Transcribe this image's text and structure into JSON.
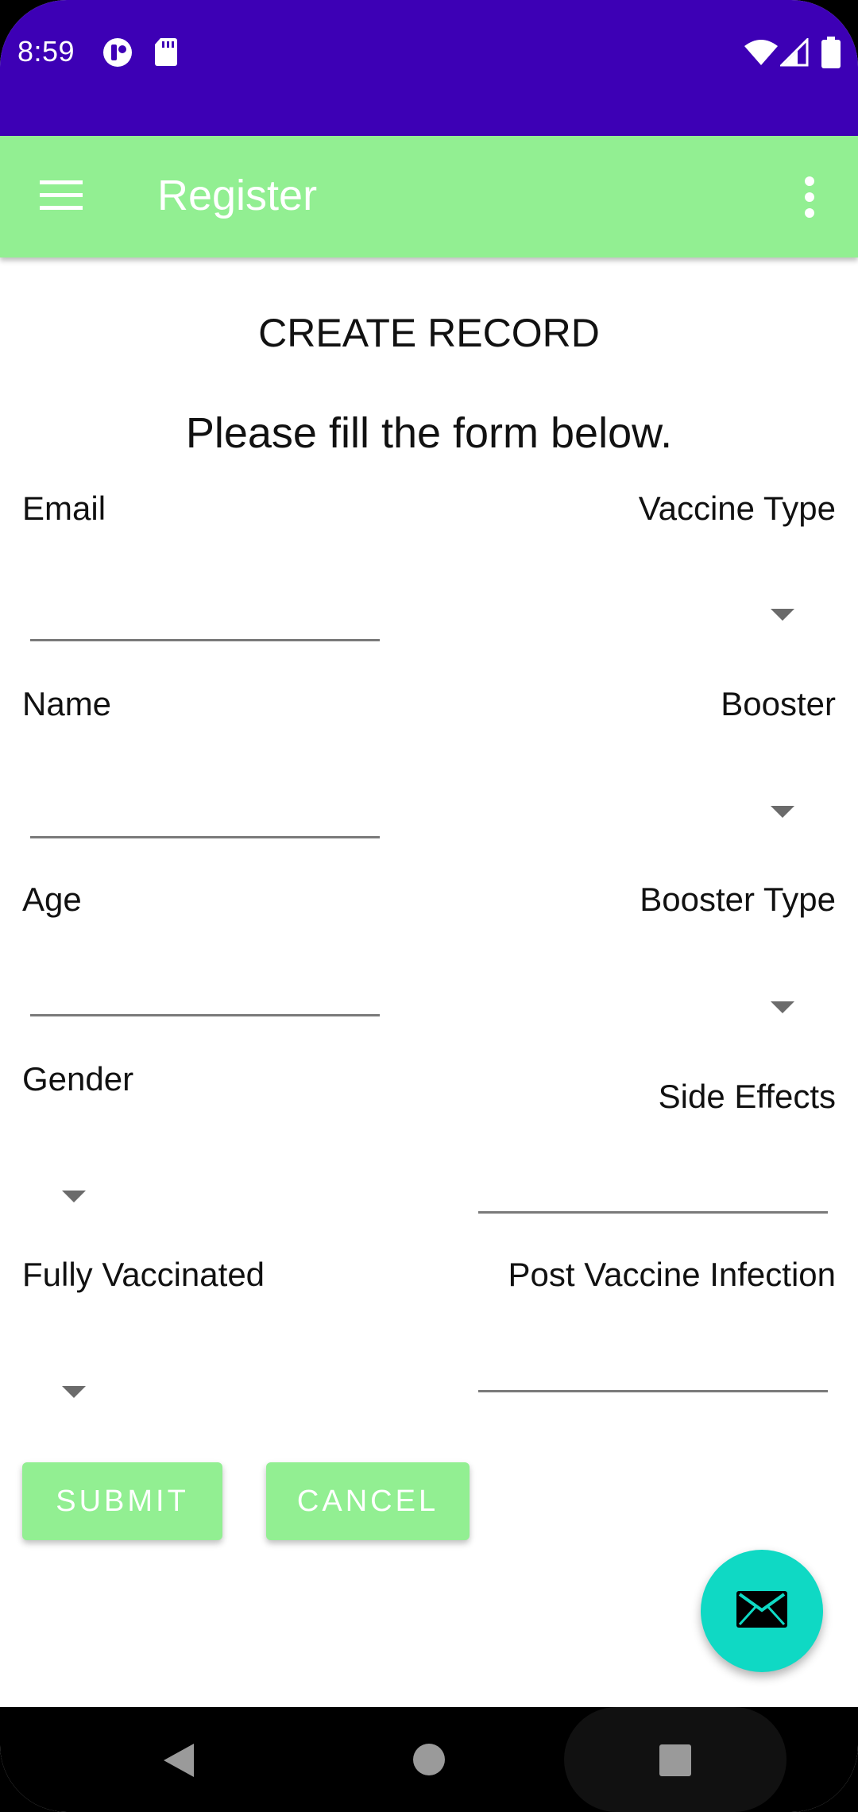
{
  "status_bar": {
    "time": "8:59",
    "background": "#3d00b5",
    "icons_left": [
      "record-icon",
      "sd-card-icon"
    ],
    "icons_right": [
      "wifi-icon",
      "signal-icon",
      "battery-icon"
    ]
  },
  "app_bar": {
    "title": "Register",
    "background": "#92ef92",
    "menu_icon": "hamburger-menu-icon",
    "overflow_icon": "more-vert-icon"
  },
  "form": {
    "heading": "CREATE RECORD",
    "subheading": "Please fill the form below.",
    "left_fields": [
      {
        "label": "Email",
        "type": "text",
        "value": ""
      },
      {
        "label": "Name",
        "type": "text",
        "value": ""
      },
      {
        "label": "Age",
        "type": "text",
        "value": ""
      },
      {
        "label": "Gender",
        "type": "dropdown",
        "value": ""
      },
      {
        "label": "Fully Vaccinated",
        "type": "dropdown",
        "value": ""
      }
    ],
    "right_fields": [
      {
        "label": "Vaccine Type",
        "type": "dropdown",
        "value": ""
      },
      {
        "label": "Booster",
        "type": "dropdown",
        "value": ""
      },
      {
        "label": "Booster Type",
        "type": "dropdown",
        "value": ""
      },
      {
        "label": "Side Effects",
        "type": "text",
        "value": ""
      },
      {
        "label": "Post Vaccine Infection",
        "type": "text",
        "value": ""
      }
    ],
    "submit_label": "SUBMIT",
    "cancel_label": "CANCEL",
    "button_color": "#92ef92"
  },
  "fab": {
    "icon": "email-icon",
    "color": "#0fd9c4"
  },
  "nav_bar": {
    "icons": [
      "back-icon",
      "home-icon",
      "recents-icon"
    ]
  }
}
